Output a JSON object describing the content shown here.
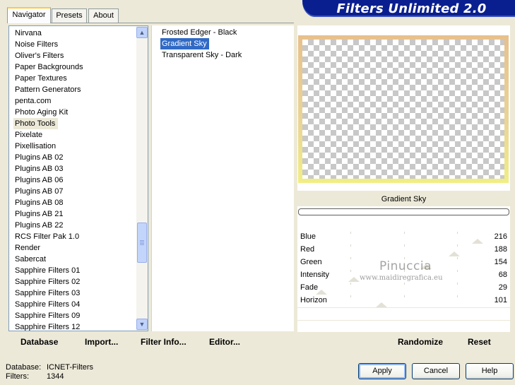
{
  "window": {
    "title": "Filters Unlimited 2.0"
  },
  "tabs": [
    {
      "label": "Navigator",
      "active": true
    },
    {
      "label": "Presets",
      "active": false
    },
    {
      "label": "About",
      "active": false
    }
  ],
  "categories": [
    "Nirvana",
    "Noise Filters",
    "Oliver's Filters",
    "Paper Backgrounds",
    "Paper Textures",
    "Pattern Generators",
    "penta.com",
    "Photo Aging Kit",
    "Photo Tools",
    "Pixelate",
    "Pixellisation",
    "Plugins AB 02",
    "Plugins AB 03",
    "Plugins AB 06",
    "Plugins AB 07",
    "Plugins AB 08",
    "Plugins AB 21",
    "Plugins AB 22",
    "RCS Filter Pak 1.0",
    "Render",
    "Sabercat",
    "Sapphire Filters 01",
    "Sapphire Filters 02",
    "Sapphire Filters 03",
    "Sapphire Filters 04",
    "Sapphire Filters 09",
    "Sapphire Filters 12"
  ],
  "selected_category": "Photo Tools",
  "filters": [
    "Frosted Edger - Black",
    "Gradient Sky",
    "Transparent Sky - Dark"
  ],
  "selected_filter": "Gradient Sky",
  "toolbar": {
    "database": "Database",
    "import": "Import...",
    "filter_info": "Filter Info...",
    "editor": "Editor..."
  },
  "preview": {
    "filter_name": "Gradient Sky"
  },
  "parameters": [
    {
      "label": "Blue",
      "value": "216",
      "level": 216
    },
    {
      "label": "Red",
      "value": "188",
      "level": 188
    },
    {
      "label": "Green",
      "value": "154",
      "level": 154
    },
    {
      "label": "Intensity",
      "value": "68",
      "level": 68
    },
    {
      "label": "Fade",
      "value": "29",
      "level": 29
    },
    {
      "label": "Horizon",
      "value": "101",
      "level": 101
    }
  ],
  "right_toolbar": {
    "randomize": "Randomize",
    "reset": "Reset"
  },
  "watermark": {
    "line1": "Pinuccia",
    "line2": "www.maidiregrafica.eu"
  },
  "status": {
    "database_label": "Database:",
    "database_value": "ICNET-Filters",
    "filters_label": "Filters:",
    "filters_value": "1344"
  },
  "buttons": {
    "apply": "Apply",
    "cancel": "Cancel",
    "help": "Help"
  },
  "colors": {
    "selection": "#316AC5",
    "banner": "#0A1F8F"
  }
}
